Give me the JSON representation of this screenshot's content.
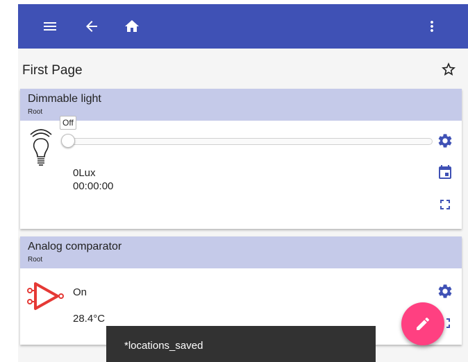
{
  "appbar": {
    "menu_icon": "menu-icon",
    "back_icon": "arrow-back-icon",
    "home_icon": "home-icon",
    "more_icon": "more-vert-icon"
  },
  "page": {
    "title": "First Page",
    "favorite_icon": "star-outline-icon"
  },
  "cards": [
    {
      "title": "Dimmable light",
      "subtitle": "Root",
      "icon": "light-bulb-icon",
      "slider_tooltip": "Off",
      "slider_value": 0,
      "value": "0Lux",
      "time": "00:00:00",
      "actions": [
        "gear-icon",
        "calendar-icon",
        "fullscreen-icon"
      ]
    },
    {
      "title": "Analog comparator",
      "subtitle": "Root",
      "icon": "comparator-icon",
      "state": "On",
      "value": "28.4°C",
      "actions": [
        "gear-icon",
        "fullscreen-icon"
      ]
    }
  ],
  "snackbar": {
    "text": "*locations_saved"
  },
  "fab": {
    "icon": "edit-icon"
  },
  "colors": {
    "appbar": "#3f51b5",
    "card_header": "#c5cae9",
    "icon_accent": "#3f51b5",
    "fab": "#ff4081",
    "comparator_red": "#e53935",
    "snackbar": "#323232"
  }
}
